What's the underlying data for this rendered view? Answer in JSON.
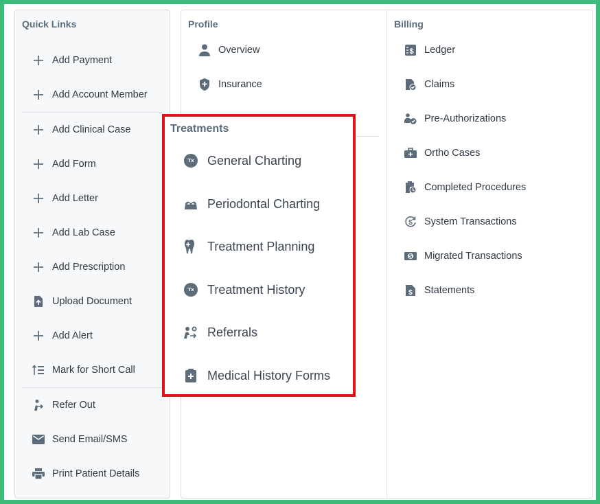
{
  "quick_links": {
    "title": "Quick Links",
    "items": [
      {
        "label": "Add Payment",
        "icon": "plus-icon"
      },
      {
        "label": "Add Account Member",
        "icon": "plus-icon"
      },
      {
        "label": "Add Clinical Case",
        "icon": "plus-icon"
      },
      {
        "label": "Add Form",
        "icon": "plus-icon"
      },
      {
        "label": "Add Letter",
        "icon": "plus-icon"
      },
      {
        "label": "Add Lab Case",
        "icon": "plus-icon"
      },
      {
        "label": "Add Prescription",
        "icon": "plus-icon"
      },
      {
        "label": "Upload Document",
        "icon": "upload-document-icon"
      },
      {
        "label": "Add Alert",
        "icon": "plus-icon"
      },
      {
        "label": "Mark for Short Call",
        "icon": "short-call-list-icon"
      },
      {
        "label": "Refer Out",
        "icon": "refer-out-icon"
      },
      {
        "label": "Send Email/SMS",
        "icon": "envelope-icon"
      },
      {
        "label": "Print Patient Details",
        "icon": "printer-icon"
      }
    ]
  },
  "profile": {
    "title": "Profile",
    "items": [
      {
        "label": "Overview",
        "icon": "person-icon"
      },
      {
        "label": "Insurance",
        "icon": "shield-plus-icon"
      }
    ]
  },
  "billing": {
    "title": "Billing",
    "items": [
      {
        "label": "Ledger",
        "icon": "ledger-icon"
      },
      {
        "label": "Claims",
        "icon": "claims-icon"
      },
      {
        "label": "Pre-Authorizations",
        "icon": "pre-authorization-icon"
      },
      {
        "label": "Ortho Cases",
        "icon": "briefcase-icon"
      },
      {
        "label": "Completed Procedures",
        "icon": "completed-procedures-icon"
      },
      {
        "label": "System Transactions",
        "icon": "dollar-cycle-icon"
      },
      {
        "label": "Migrated Transactions",
        "icon": "migrated-cash-icon"
      },
      {
        "label": "Statements",
        "icon": "statement-icon"
      }
    ]
  },
  "treatments": {
    "title": "Treatments",
    "badge_text": "Tx",
    "items": [
      {
        "label": "General Charting",
        "icon": "tx-badge-icon"
      },
      {
        "label": "Periodontal Charting",
        "icon": "gum-icon"
      },
      {
        "label": "Treatment Planning",
        "icon": "tooth-plus-icon"
      },
      {
        "label": "Treatment History",
        "icon": "tx-badge-icon"
      },
      {
        "label": "Referrals",
        "icon": "referral-icon"
      },
      {
        "label": "Medical History Forms",
        "icon": "medical-clipboard-icon"
      }
    ]
  },
  "colors": {
    "frame_border": "#3dbb7a",
    "highlight_border": "#e0141b",
    "icon": "#5d6c7b",
    "heading": "#5a6b7d"
  }
}
